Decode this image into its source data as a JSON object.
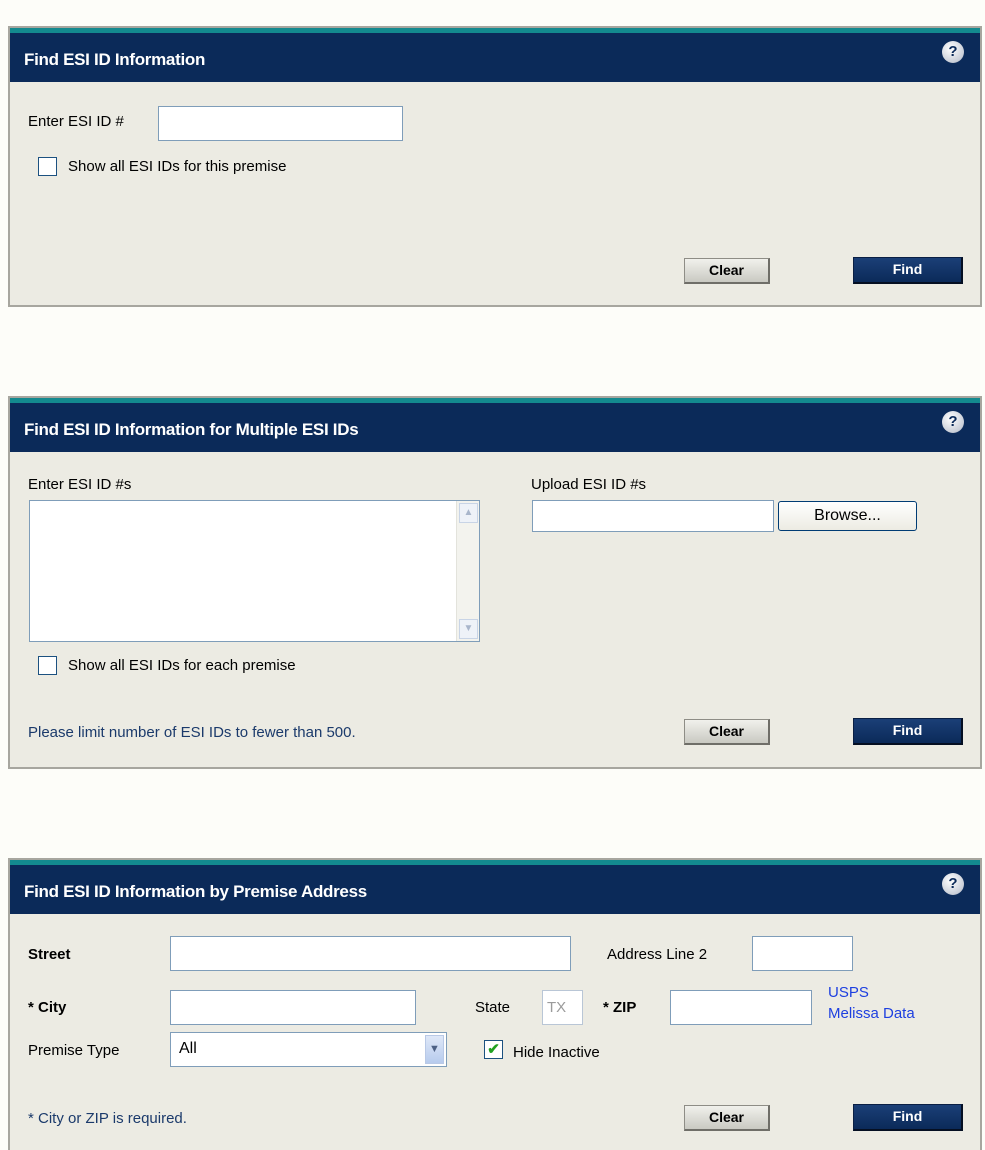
{
  "panel1": {
    "title": "Find ESI ID Information",
    "help": "?",
    "esi_label": "Enter ESI ID #",
    "esi_value": "",
    "show_all_label": "Show all ESI IDs for this premise",
    "show_all_checked": false,
    "clear_label": "Clear",
    "find_label": "Find"
  },
  "panel2": {
    "title": "Find ESI ID Information for Multiple ESI IDs",
    "help": "?",
    "enter_label": "Enter ESI ID #s",
    "upload_label": "Upload ESI ID #s",
    "browse_label": "Browse...",
    "show_all_label": "Show all ESI IDs for each premise",
    "show_all_checked": false,
    "limit_note": "Please limit number of ESI IDs to fewer than 500.",
    "clear_label": "Clear",
    "find_label": "Find"
  },
  "panel3": {
    "title": "Find ESI ID Information by Premise Address",
    "help": "?",
    "street_label": "Street",
    "address2_label": "Address Line 2",
    "city_label": "* City",
    "state_label": "State",
    "state_value": "TX",
    "zip_label": "* ZIP",
    "usps_link": "USPS",
    "melissa_link": "Melissa Data",
    "premise_type_label": "Premise Type",
    "premise_type_value": "All",
    "hide_inactive_label": "Hide Inactive",
    "hide_inactive_checked": true,
    "required_note": "* City or ZIP is required.",
    "clear_label": "Clear",
    "find_label": "Find"
  }
}
